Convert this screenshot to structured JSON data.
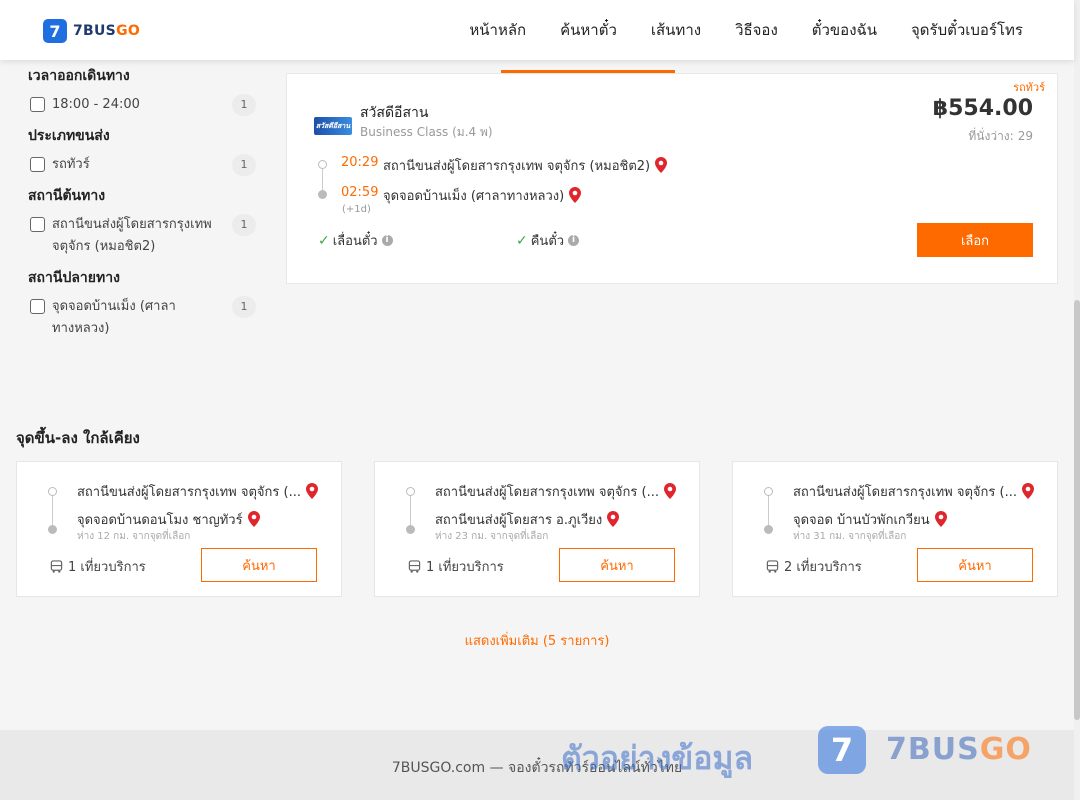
{
  "header": {
    "logo_mark": "7",
    "logo_name": "7BUS",
    "logo_accent": "GO",
    "nav": [
      "หน้าหลัก",
      "ค้นหาตั๋ว",
      "เส้นทาง",
      "วิธีจอง",
      "ตั๋วของฉัน",
      "จุดรับตั๋วเบอร์โทร"
    ]
  },
  "filters": [
    {
      "title": "เวลาออกเดินทาง",
      "options": [
        {
          "label": "18:00 - 24:00",
          "count": "1"
        }
      ]
    },
    {
      "title": "ประเภทขนส่ง",
      "options": [
        {
          "label": "รถทัวร์",
          "count": "1"
        }
      ]
    },
    {
      "title": "สถานีต้นทาง",
      "options": [
        {
          "label": "สถานีขนส่งผู้โดยสารกรุงเทพ จตุจักร (หมอชิต2)",
          "count": "1"
        }
      ]
    },
    {
      "title": "สถานีปลายทาง",
      "options": [
        {
          "label": "จุดจอดบ้านเม็ง (ศาลาทางหลวง)",
          "count": "1"
        }
      ]
    }
  ],
  "result": {
    "bus_type": "รถทัวร์",
    "operator_logo_text": "สวัสดีอีสาน",
    "operator_name": "สวัสดีอีสาน",
    "bus_class": "Business Class (ม.4 พ)",
    "price": "฿554.00",
    "seats_label": "ที่นั่งว่าง:",
    "seats": "29",
    "depart_time": "20:29",
    "depart_station": "สถานีขนส่งผู้โดยสารกรุงเทพ จตุจักร (หมอชิต2)",
    "arrive_time": "02:59",
    "arrive_station": "จุดจอดบ้านเม็ง (ศาลาทางหลวง)",
    "day_offset": "(+1d)",
    "feature_1": "เลื่อนตั๋ว",
    "feature_2": "คืนตั๋ว",
    "select_label": "เลือก"
  },
  "nearby": {
    "title": "จุดขึ้น-ลง ใกล้เคียง",
    "cards": [
      {
        "from": "สถานีขนส่งผู้โดยสารกรุงเทพ จตุจักร (...",
        "to": "จุดจอดบ้านดอนโมง ชาญทัวร์",
        "distance": "ห่าง 12 กม. จากจุดที่เลือก",
        "trips": "1 เที่ยวบริการ",
        "button": "ค้นหา"
      },
      {
        "from": "สถานีขนส่งผู้โดยสารกรุงเทพ จตุจักร (...",
        "to": "สถานีขนส่งผู้โดยสาร อ.ภูเวียง",
        "distance": "ห่าง 23 กม. จากจุดที่เลือก",
        "trips": "1 เที่ยวบริการ",
        "button": "ค้นหา"
      },
      {
        "from": "สถานีขนส่งผู้โดยสารกรุงเทพ จตุจักร (...",
        "to": "จุดจอด บ้านบัวพักเกวียน",
        "distance": "ห่าง 31 กม. จากจุดที่เลือก",
        "trips": "2 เที่ยวบริการ",
        "button": "ค้นหา"
      }
    ],
    "show_more": "แสดงเพิ่มเติม (5 รายการ)"
  },
  "footer": {
    "text": "7BUSGO.com — จองตั๋วรถทัวร์ออนไลน์ทั่วไทย",
    "watermark_text": "ตัวอย่างข้อมูล",
    "watermark_mark": "7",
    "watermark_name": "7BUS",
    "watermark_accent": "GO"
  },
  "colors": {
    "accent": "#ff6a00",
    "brand": "#1f6fe0",
    "check": "#3aa845",
    "pin": "#e0262d"
  }
}
